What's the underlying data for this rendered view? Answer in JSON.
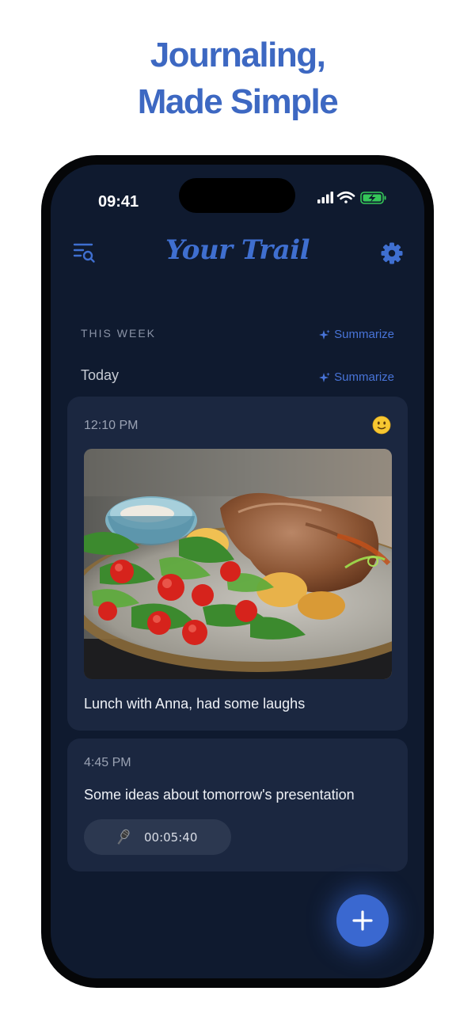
{
  "promo": {
    "headline_line1": "Journaling,",
    "headline_line2": "Made Simple",
    "color": "#3d68c2"
  },
  "status_bar": {
    "time": "09:41",
    "icons": [
      "signal-icon",
      "wifi-icon",
      "battery-charging-icon"
    ]
  },
  "header": {
    "title": "Your Trail",
    "left_icon": "filter-search-icon",
    "right_icon": "gear-icon"
  },
  "section": {
    "label": "THIS WEEK",
    "summarize_label": "Summarize"
  },
  "day_group": {
    "label": "Today",
    "summarize_label": "Summarize"
  },
  "entries": [
    {
      "time": "12:10 PM",
      "mood_icon": "slightly-smiling-face-icon",
      "photo": "plate of grilled meat with tomato salad and potatoes",
      "text": "Lunch with Anna, had some laughs"
    },
    {
      "time": "4:45 PM",
      "text": "Some ideas about tomorrow's presentation",
      "audio": {
        "icon": "microphone-icon",
        "duration": "00:05:40"
      }
    }
  ],
  "fab": {
    "icon": "plus-icon"
  },
  "colors": {
    "screen_bg": "#0f1a2f",
    "card_bg": "#1b2740",
    "accent": "#3f6fd0"
  }
}
